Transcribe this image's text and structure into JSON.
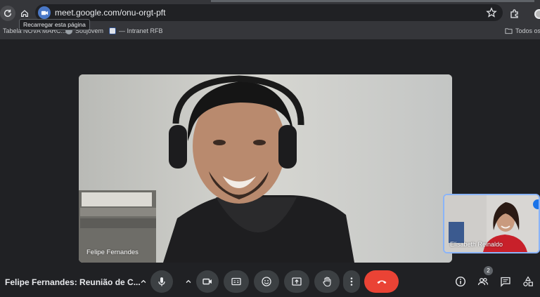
{
  "browser": {
    "url": "meet.google.com/onu-orgt-pft",
    "reload_tooltip": "Recarregar esta página",
    "bookmarks": [
      {
        "label": "Tabela NOVA MARC..."
      },
      {
        "label": "Soujovem"
      },
      {
        "label": "— Intranet RFB"
      }
    ],
    "all_bookmarks_label": "Todos os"
  },
  "meeting": {
    "title": "Felipe Fernandes: Reunião de C...",
    "main_participant": "Felipe Fernandes",
    "self_participant": "Elisabeth Reinaldo",
    "participant_count": "2"
  },
  "icons": {
    "reload": "reload-icon",
    "home": "home-icon",
    "site": "google-meet-icon",
    "star": "star-icon",
    "extensions": "extensions-icon",
    "mic": "microphone-icon",
    "camera": "camera-icon",
    "captions": "captions-icon",
    "emoji": "emoji-icon",
    "present": "present-screen-icon",
    "hand": "raise-hand-icon",
    "more": "more-options-icon",
    "end_call": "end-call-icon",
    "info": "info-icon",
    "people": "people-icon",
    "chat": "chat-icon",
    "activities": "activities-icon"
  },
  "colors": {
    "background": "#202124",
    "control": "#3c4043",
    "end_call": "#ea4335",
    "self_view_border": "#8ab4f8"
  }
}
